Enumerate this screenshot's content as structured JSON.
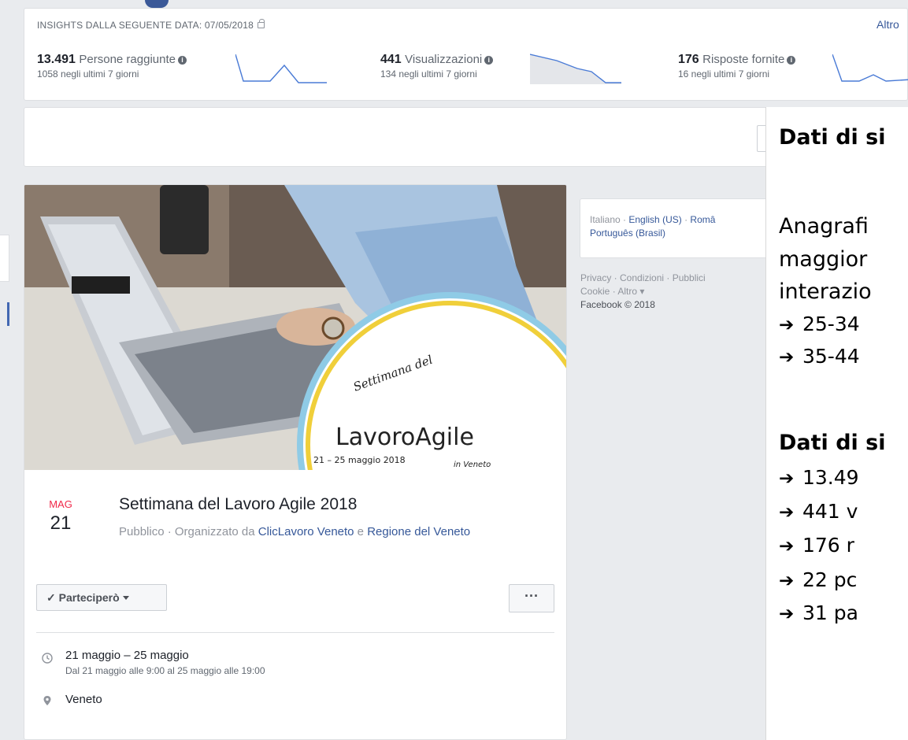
{
  "insights": {
    "header": "INSIGHTS DALLA SEGUENTE DATA: 07/05/2018",
    "more_link": "Altro",
    "metrics": [
      {
        "value": "13.491",
        "label": "Persone raggiunte",
        "sub": "1058 negli ultimi 7 giorni"
      },
      {
        "value": "441",
        "label": "Visualizzazioni",
        "sub": "134 negli ultimi 7 giorni"
      },
      {
        "value": "176",
        "label": "Risposte fornite",
        "sub": "16 negli ultimi 7 giorni"
      }
    ]
  },
  "event": {
    "month": "MAG",
    "day": "21",
    "title": "Settimana del Lavoro Agile 2018",
    "meta_prefix": "Pubblico · Organizzato da ",
    "organizer1": "ClicLavoro Veneto",
    "meta_join": " e ",
    "organizer2": "Regione del Veneto",
    "going_button": "✓ Parteciperò",
    "more_button": "···",
    "when_main": "21 maggio – 25 maggio",
    "when_sub": "Dal 21 maggio alle 9:00 al 25 maggio alle 19:00",
    "where": "Veneto",
    "cover_logo": {
      "line1": "Settimana del",
      "line2": "LavoroAgile",
      "dates": "21 – 25 maggio 2018",
      "region": "in Veneto"
    }
  },
  "languages": {
    "lang1": "Italiano",
    "sep": " · ",
    "lang2": "English (US)",
    "lang3": "Româ",
    "lang4": "Português (Brasil)"
  },
  "footer": {
    "line1": "Privacy · Condizioni · Pubblici",
    "line2": "Cookie · Altro ▾",
    "copyright": "Facebook © 2018"
  },
  "panel": {
    "heading1": "Dati di si",
    "text1": "Anagrafi",
    "text2": "maggior",
    "text3": "interazio",
    "bullet1": "25-34",
    "bullet2": "35-44",
    "heading2": "Dati di si",
    "bullet3": "13.49",
    "bullet4": "441 v",
    "bullet5": "176 r",
    "bullet6": "22 pc",
    "bullet7": "31 pa",
    "arrow": "➔"
  },
  "colors": {
    "link": "#365899",
    "accent": "#4267b2",
    "date_red": "#f02849"
  }
}
